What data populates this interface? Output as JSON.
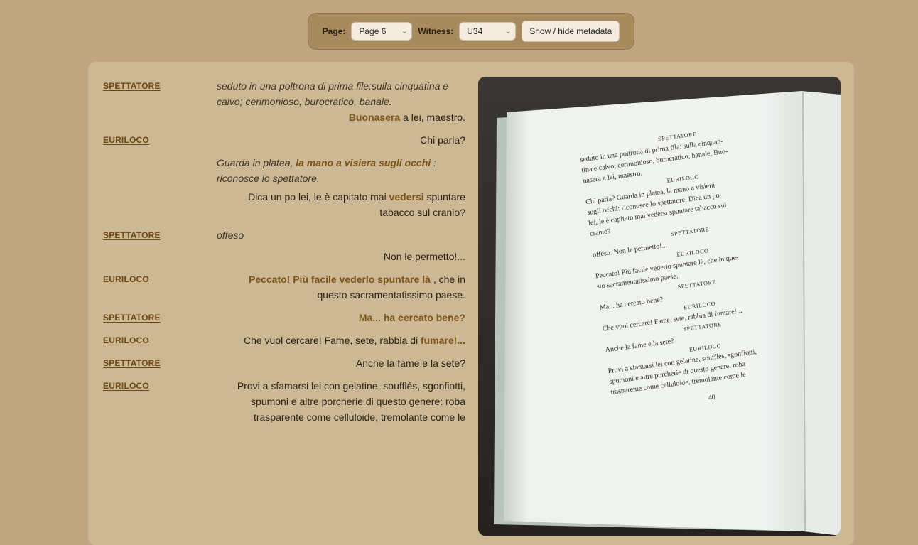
{
  "toolbar": {
    "page_label": "Page:",
    "page_value": "Page 6",
    "witness_label": "Witness:",
    "witness_value": "U34",
    "metadata_button": "Show / hide metadata"
  },
  "text": {
    "r1": {
      "speaker": "SPETTATORE",
      "stage": "seduto in una poltrona di prima file:sulla cinquatina e calvo; cerimonioso, burocratico, banale.",
      "hl": "Buonasera",
      "rest": " a lei, maestro."
    },
    "r2": {
      "speaker": "EURILOCO",
      "line1": "Chi parla?",
      "stage_a": "Guarda in platea, ",
      "stage_hl": "la mano a visiera sugli occhi",
      "stage_b": " : riconosce lo spettatore.",
      "line2_a": "Dica un po lei, le è capitato mai ",
      "line2_hl": "vedersi",
      "line2_b": " spuntare tabacco sul cranio?"
    },
    "r3": {
      "speaker": "SPETTATORE",
      "stage": "offeso",
      "line": "Non le permetto!..."
    },
    "r4": {
      "speaker": "EURILOCO",
      "hl": "Peccato! Più facile vederlo spuntare là",
      "rest": " , che in questo sacramentatissimo paese."
    },
    "r5": {
      "speaker": "SPETTATORE",
      "hl": "Ma... ha cercato bene?"
    },
    "r6": {
      "speaker": "EURILOCO",
      "a": "Che vuol cercare! Fame, sete, rabbia di ",
      "hl": "fumare!..."
    },
    "r7": {
      "speaker": "SPETTATORE",
      "line": "Anche la fame e la sete?"
    },
    "r8": {
      "speaker": "EURILOCO",
      "line": "Provi a sfamarsi lei con gelatine, soufflés, sgonfiotti, spumoni e altre porcherie di questo genere: roba trasparente come celluloide, tremolante come le"
    }
  },
  "scan": {
    "lines": [
      "Spettatore",
      "seduto in una poltrona di prima fila: sulla cinquan-",
      "tina e calvo; cerimonioso, burocratico, banale.   Buo-",
      "nasera a lei, maestro.",
      "Euriloco",
      "Chi parla?   Guarda in platea, la mano a visiera",
      "sugli occhi: riconosce lo spettatore.   Dica un po",
      "lei, le è capitato mai vedersi spuntare tabacco sul",
      "cranio?",
      "Spettatore",
      "offeso.   Non le permetto!...",
      "Euriloco",
      "Peccato! Più facile vederlo spuntare là, che in que-",
      "sto sacramentatissimo paese.",
      "Spettatore",
      "Ma... ha cercato bene?",
      "Euriloco",
      "Che vuol cercare! Fame, sete, rabbia di fumare!...",
      "Spettatore",
      "Anche la fame e la sete?",
      "Euriloco",
      "Provi a sfamarsi lei con gelatine, soufflés, sgonfiotti,",
      "spumoni e altre porcherie di questo genere: roba",
      "trasparente come celluloide, tremolante come le",
      "40"
    ]
  }
}
